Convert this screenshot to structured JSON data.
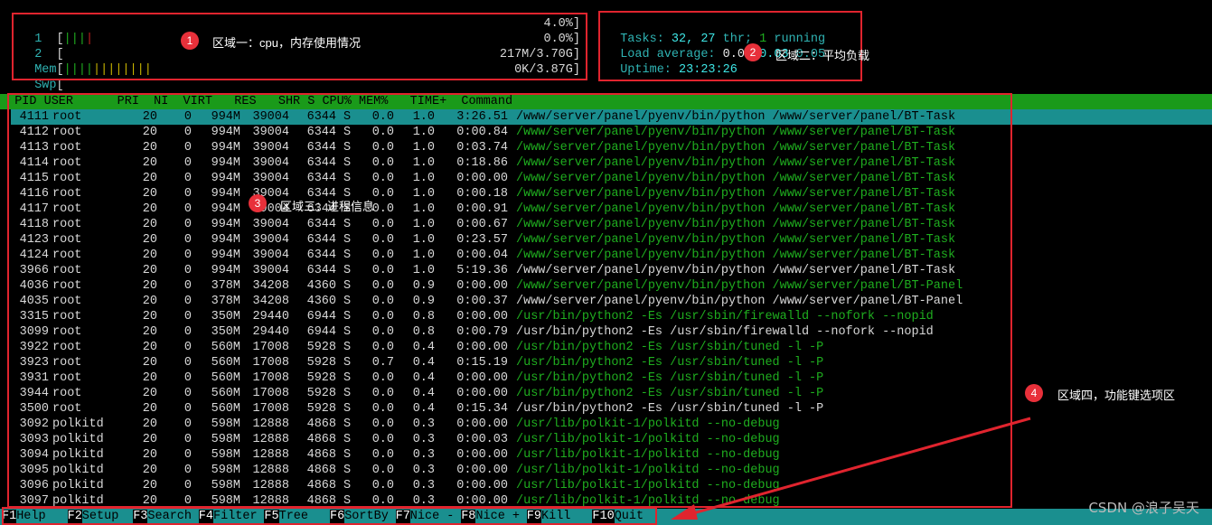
{
  "meters": {
    "cpu1": {
      "label": "1",
      "bar": "|||",
      "value": "4.0%]"
    },
    "cpu2": {
      "label": "2",
      "bar": "",
      "value": "0.0%]"
    },
    "mem": {
      "label": "Mem",
      "bar_green": "||||",
      "bar_yellow": "||||||||",
      "value": "217M/3.70G]"
    },
    "swp": {
      "label": "Swp",
      "bar": "",
      "value": "0K/3.87G]"
    }
  },
  "summary": {
    "tasks_label": "Tasks: ",
    "tasks": "32, ",
    "threads": "27 ",
    "threads_label": "thr; ",
    "running": "1 ",
    "running_label": "running",
    "load_label": "Load average: ",
    "load1": "0.07 ",
    "load5": "0.03 ",
    "load15": "0.05",
    "uptime_label": "Uptime: ",
    "uptime": "23:23:26"
  },
  "table": {
    "header": "  PID USER      PRI  NI  VIRT   RES   SHR S CPU% MEM%   TIME+  Command",
    "rows": [
      {
        "pid": "4111",
        "user": "root",
        "pri": "20",
        "ni": "0",
        "virt": "994M",
        "res": "39004",
        "shr": "6344",
        "s": "S",
        "cpu": "0.0",
        "mem": "1.0",
        "time": "3:26.51",
        "cmd": "/www/server/panel/pyenv/bin/python /www/server/panel/BT-Task",
        "thread": false,
        "selected": true
      },
      {
        "pid": "4112",
        "user": "root",
        "pri": "20",
        "ni": "0",
        "virt": "994M",
        "res": "39004",
        "shr": "6344",
        "s": "S",
        "cpu": "0.0",
        "mem": "1.0",
        "time": "0:00.84",
        "cmd": "/www/server/panel/pyenv/bin/python /www/server/panel/BT-Task",
        "thread": true
      },
      {
        "pid": "4113",
        "user": "root",
        "pri": "20",
        "ni": "0",
        "virt": "994M",
        "res": "39004",
        "shr": "6344",
        "s": "S",
        "cpu": "0.0",
        "mem": "1.0",
        "time": "0:03.74",
        "cmd": "/www/server/panel/pyenv/bin/python /www/server/panel/BT-Task",
        "thread": true
      },
      {
        "pid": "4114",
        "user": "root",
        "pri": "20",
        "ni": "0",
        "virt": "994M",
        "res": "39004",
        "shr": "6344",
        "s": "S",
        "cpu": "0.0",
        "mem": "1.0",
        "time": "0:18.86",
        "cmd": "/www/server/panel/pyenv/bin/python /www/server/panel/BT-Task",
        "thread": true
      },
      {
        "pid": "4115",
        "user": "root",
        "pri": "20",
        "ni": "0",
        "virt": "994M",
        "res": "39004",
        "shr": "6344",
        "s": "S",
        "cpu": "0.0",
        "mem": "1.0",
        "time": "0:00.00",
        "cmd": "/www/server/panel/pyenv/bin/python /www/server/panel/BT-Task",
        "thread": true
      },
      {
        "pid": "4116",
        "user": "root",
        "pri": "20",
        "ni": "0",
        "virt": "994M",
        "res": "39004",
        "shr": "6344",
        "s": "S",
        "cpu": "0.0",
        "mem": "1.0",
        "time": "0:00.18",
        "cmd": "/www/server/panel/pyenv/bin/python /www/server/panel/BT-Task",
        "thread": true
      },
      {
        "pid": "4117",
        "user": "root",
        "pri": "20",
        "ni": "0",
        "virt": "994M",
        "res": "39004",
        "shr": "6344",
        "s": "S",
        "cpu": "0.0",
        "mem": "1.0",
        "time": "0:00.91",
        "cmd": "/www/server/panel/pyenv/bin/python /www/server/panel/BT-Task",
        "thread": true
      },
      {
        "pid": "4118",
        "user": "root",
        "pri": "20",
        "ni": "0",
        "virt": "994M",
        "res": "39004",
        "shr": "6344",
        "s": "S",
        "cpu": "0.0",
        "mem": "1.0",
        "time": "0:00.67",
        "cmd": "/www/server/panel/pyenv/bin/python /www/server/panel/BT-Task",
        "thread": true
      },
      {
        "pid": "4123",
        "user": "root",
        "pri": "20",
        "ni": "0",
        "virt": "994M",
        "res": "39004",
        "shr": "6344",
        "s": "S",
        "cpu": "0.0",
        "mem": "1.0",
        "time": "0:23.57",
        "cmd": "/www/server/panel/pyenv/bin/python /www/server/panel/BT-Task",
        "thread": true
      },
      {
        "pid": "4124",
        "user": "root",
        "pri": "20",
        "ni": "0",
        "virt": "994M",
        "res": "39004",
        "shr": "6344",
        "s": "S",
        "cpu": "0.0",
        "mem": "1.0",
        "time": "0:00.04",
        "cmd": "/www/server/panel/pyenv/bin/python /www/server/panel/BT-Task",
        "thread": true
      },
      {
        "pid": "3966",
        "user": "root",
        "pri": "20",
        "ni": "0",
        "virt": "994M",
        "res": "39004",
        "shr": "6344",
        "s": "S",
        "cpu": "0.0",
        "mem": "1.0",
        "time": "5:19.36",
        "cmd": "/www/server/panel/pyenv/bin/python /www/server/panel/BT-Task",
        "thread": false
      },
      {
        "pid": "4036",
        "user": "root",
        "pri": "20",
        "ni": "0",
        "virt": "378M",
        "res": "34208",
        "shr": "4360",
        "s": "S",
        "cpu": "0.0",
        "mem": "0.9",
        "time": "0:00.00",
        "cmd": "/www/server/panel/pyenv/bin/python /www/server/panel/BT-Panel",
        "thread": true
      },
      {
        "pid": "4035",
        "user": "root",
        "pri": "20",
        "ni": "0",
        "virt": "378M",
        "res": "34208",
        "shr": "4360",
        "s": "S",
        "cpu": "0.0",
        "mem": "0.9",
        "time": "0:00.37",
        "cmd": "/www/server/panel/pyenv/bin/python /www/server/panel/BT-Panel",
        "thread": false
      },
      {
        "pid": "3315",
        "user": "root",
        "pri": "20",
        "ni": "0",
        "virt": "350M",
        "res": "29440",
        "shr": "6944",
        "s": "S",
        "cpu": "0.0",
        "mem": "0.8",
        "time": "0:00.00",
        "cmd": "/usr/bin/python2 -Es /usr/sbin/firewalld --nofork --nopid",
        "thread": true
      },
      {
        "pid": "3099",
        "user": "root",
        "pri": "20",
        "ni": "0",
        "virt": "350M",
        "res": "29440",
        "shr": "6944",
        "s": "S",
        "cpu": "0.0",
        "mem": "0.8",
        "time": "0:00.79",
        "cmd": "/usr/bin/python2 -Es /usr/sbin/firewalld --nofork --nopid",
        "thread": false
      },
      {
        "pid": "3922",
        "user": "root",
        "pri": "20",
        "ni": "0",
        "virt": "560M",
        "res": "17008",
        "shr": "5928",
        "s": "S",
        "cpu": "0.0",
        "mem": "0.4",
        "time": "0:00.00",
        "cmd": "/usr/bin/python2 -Es /usr/sbin/tuned -l -P",
        "thread": true
      },
      {
        "pid": "3923",
        "user": "root",
        "pri": "20",
        "ni": "0",
        "virt": "560M",
        "res": "17008",
        "shr": "5928",
        "s": "S",
        "cpu": "0.7",
        "mem": "0.4",
        "time": "0:15.19",
        "cmd": "/usr/bin/python2 -Es /usr/sbin/tuned -l -P",
        "thread": true
      },
      {
        "pid": "3931",
        "user": "root",
        "pri": "20",
        "ni": "0",
        "virt": "560M",
        "res": "17008",
        "shr": "5928",
        "s": "S",
        "cpu": "0.0",
        "mem": "0.4",
        "time": "0:00.00",
        "cmd": "/usr/bin/python2 -Es /usr/sbin/tuned -l -P",
        "thread": true
      },
      {
        "pid": "3944",
        "user": "root",
        "pri": "20",
        "ni": "0",
        "virt": "560M",
        "res": "17008",
        "shr": "5928",
        "s": "S",
        "cpu": "0.0",
        "mem": "0.4",
        "time": "0:00.00",
        "cmd": "/usr/bin/python2 -Es /usr/sbin/tuned -l -P",
        "thread": true
      },
      {
        "pid": "3500",
        "user": "root",
        "pri": "20",
        "ni": "0",
        "virt": "560M",
        "res": "17008",
        "shr": "5928",
        "s": "S",
        "cpu": "0.0",
        "mem": "0.4",
        "time": "0:15.34",
        "cmd": "/usr/bin/python2 -Es /usr/sbin/tuned -l -P",
        "thread": false
      },
      {
        "pid": "3092",
        "user": "polkitd",
        "pri": "20",
        "ni": "0",
        "virt": "598M",
        "res": "12888",
        "shr": "4868",
        "s": "S",
        "cpu": "0.0",
        "mem": "0.3",
        "time": "0:00.00",
        "cmd": "/usr/lib/polkit-1/polkitd --no-debug",
        "thread": true
      },
      {
        "pid": "3093",
        "user": "polkitd",
        "pri": "20",
        "ni": "0",
        "virt": "598M",
        "res": "12888",
        "shr": "4868",
        "s": "S",
        "cpu": "0.0",
        "mem": "0.3",
        "time": "0:00.03",
        "cmd": "/usr/lib/polkit-1/polkitd --no-debug",
        "thread": true
      },
      {
        "pid": "3094",
        "user": "polkitd",
        "pri": "20",
        "ni": "0",
        "virt": "598M",
        "res": "12888",
        "shr": "4868",
        "s": "S",
        "cpu": "0.0",
        "mem": "0.3",
        "time": "0:00.00",
        "cmd": "/usr/lib/polkit-1/polkitd --no-debug",
        "thread": true
      },
      {
        "pid": "3095",
        "user": "polkitd",
        "pri": "20",
        "ni": "0",
        "virt": "598M",
        "res": "12888",
        "shr": "4868",
        "s": "S",
        "cpu": "0.0",
        "mem": "0.3",
        "time": "0:00.00",
        "cmd": "/usr/lib/polkit-1/polkitd --no-debug",
        "thread": true
      },
      {
        "pid": "3096",
        "user": "polkitd",
        "pri": "20",
        "ni": "0",
        "virt": "598M",
        "res": "12888",
        "shr": "4868",
        "s": "S",
        "cpu": "0.0",
        "mem": "0.3",
        "time": "0:00.00",
        "cmd": "/usr/lib/polkit-1/polkitd --no-debug",
        "thread": true
      },
      {
        "pid": "3097",
        "user": "polkitd",
        "pri": "20",
        "ni": "0",
        "virt": "598M",
        "res": "12888",
        "shr": "4868",
        "s": "S",
        "cpu": "0.0",
        "mem": "0.3",
        "time": "0:00.00",
        "cmd": "/usr/lib/polkit-1/polkitd --no-debug",
        "thread": true
      }
    ]
  },
  "function_keys": [
    {
      "key": "F1",
      "label": "Help  "
    },
    {
      "key": "F2",
      "label": "Setup "
    },
    {
      "key": "F3",
      "label": "Search"
    },
    {
      "key": "F4",
      "label": "Filter"
    },
    {
      "key": "F5",
      "label": "Tree  "
    },
    {
      "key": "F6",
      "label": "SortBy"
    },
    {
      "key": "F7",
      "label": "Nice -"
    },
    {
      "key": "F8",
      "label": "Nice +"
    },
    {
      "key": "F9",
      "label": "Kill  "
    },
    {
      "key": "F10",
      "label": "Quit"
    }
  ],
  "annotations": {
    "b1": "1",
    "n1": "区域一：cpu，内存使用情况",
    "b2": "2",
    "n2": "区域二：平均负载",
    "b3": "3",
    "n3": "区域三：进程信息",
    "b4": "4",
    "n4": "区域四，功能键选项区"
  },
  "watermark": "CSDN @浪子吴天",
  "colors": {
    "header_bg": "#1a9a1a",
    "selected_bg": "#1a8f8f",
    "thread": "#1fae1f",
    "annotation": "#e0242e"
  }
}
